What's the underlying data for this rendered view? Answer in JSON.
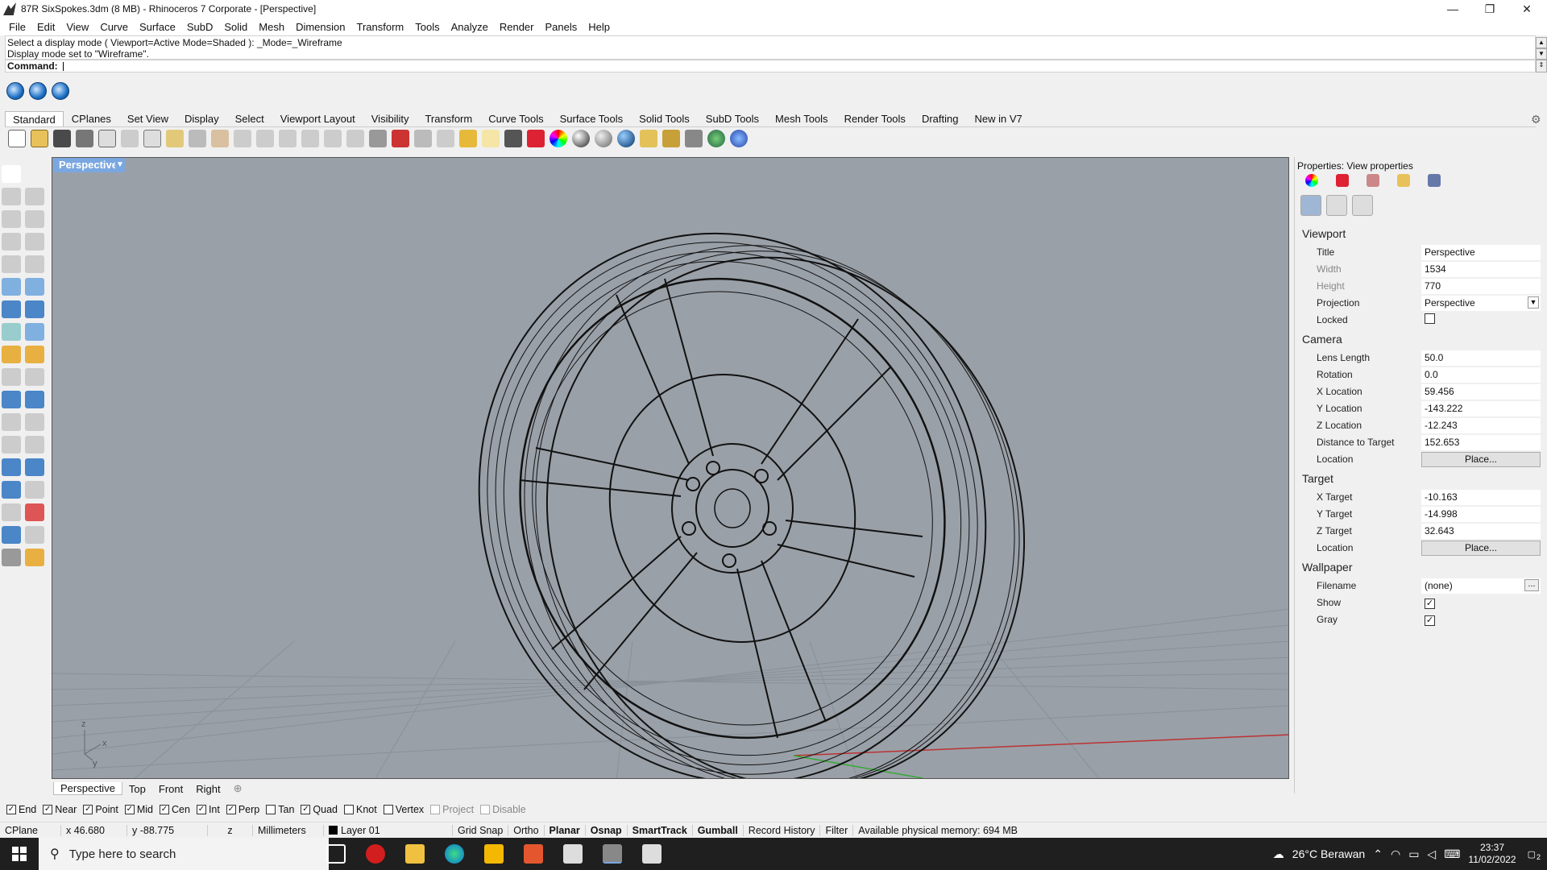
{
  "window": {
    "title": "87R SixSpokes.3dm (8 MB) - Rhinoceros 7 Corporate - [Perspective]",
    "minimize": "—",
    "restore": "❐",
    "close": "✕"
  },
  "menu": [
    "File",
    "Edit",
    "View",
    "Curve",
    "Surface",
    "SubD",
    "Solid",
    "Mesh",
    "Dimension",
    "Transform",
    "Tools",
    "Analyze",
    "Render",
    "Panels",
    "Help"
  ],
  "command": {
    "history_line1": "Select a display mode ( Viewport=Active  Mode=Shaded ): _Mode=_Wireframe",
    "history_line2": "Display mode set to \"Wireframe\".",
    "prompt": "Command:"
  },
  "toolbar_tabs": [
    "Standard",
    "CPlanes",
    "Set View",
    "Display",
    "Select",
    "Viewport Layout",
    "Visibility",
    "Transform",
    "Curve Tools",
    "Surface Tools",
    "Solid Tools",
    "SubD Tools",
    "Mesh Tools",
    "Render Tools",
    "Drafting",
    "New in V7"
  ],
  "viewport": {
    "label": "Perspective",
    "tabs": [
      "Perspective",
      "Top",
      "Front",
      "Right"
    ],
    "add_tab": "⊕",
    "axis_z": "z",
    "axis_y": "y",
    "axis_x": "x"
  },
  "properties": {
    "title": "Properties: View properties",
    "sections": {
      "viewport": "Viewport",
      "camera": "Camera",
      "target": "Target",
      "wallpaper": "Wallpaper"
    },
    "viewport": {
      "title_label": "Title",
      "title_value": "Perspective",
      "width_label": "Width",
      "width_value": "1534",
      "height_label": "Height",
      "height_value": "770",
      "projection_label": "Projection",
      "projection_value": "Perspective",
      "locked_label": "Locked",
      "locked": false
    },
    "camera": {
      "lens_label": "Lens Length",
      "lens_value": "50.0",
      "rotation_label": "Rotation",
      "rotation_value": "0.0",
      "x_label": "X Location",
      "x_value": "59.456",
      "y_label": "Y Location",
      "y_value": "-143.222",
      "z_label": "Z Location",
      "z_value": "-12.243",
      "dist_label": "Distance to Target",
      "dist_value": "152.653",
      "loc_label": "Location",
      "loc_button": "Place..."
    },
    "target": {
      "x_label": "X Target",
      "x_value": "-10.163",
      "y_label": "Y Target",
      "y_value": "-14.998",
      "z_label": "Z Target",
      "z_value": "32.643",
      "loc_label": "Location",
      "loc_button": "Place..."
    },
    "wallpaper": {
      "filename_label": "Filename",
      "filename_value": "(none)",
      "browse": "...",
      "show_label": "Show",
      "show": true,
      "gray_label": "Gray",
      "gray": true
    }
  },
  "osnaps": [
    {
      "label": "End",
      "checked": true
    },
    {
      "label": "Near",
      "checked": true
    },
    {
      "label": "Point",
      "checked": true
    },
    {
      "label": "Mid",
      "checked": true
    },
    {
      "label": "Cen",
      "checked": true
    },
    {
      "label": "Int",
      "checked": true
    },
    {
      "label": "Perp",
      "checked": true
    },
    {
      "label": "Tan",
      "checked": false
    },
    {
      "label": "Quad",
      "checked": true
    },
    {
      "label": "Knot",
      "checked": false
    },
    {
      "label": "Vertex",
      "checked": false
    },
    {
      "label": "Project",
      "checked": false,
      "disabled": true
    },
    {
      "label": "Disable",
      "checked": false,
      "disabled": true
    }
  ],
  "status": {
    "cplane": "CPlane",
    "x": "x 46.680",
    "y": "y -88.775",
    "z": "z",
    "units": "Millimeters",
    "layer": "Layer 01",
    "grid_snap": "Grid Snap",
    "ortho": "Ortho",
    "planar": "Planar",
    "osnap": "Osnap",
    "smarttrack": "SmartTrack",
    "gumball": "Gumball",
    "record_history": "Record History",
    "filter": "Filter",
    "memory": "Available physical memory: 694 MB"
  },
  "taskbar": {
    "search_placeholder": "Type here to search",
    "weather": "26°C  Berawan",
    "time": "23:37",
    "date": "11/02/2022",
    "notification_count": "2"
  },
  "colors": {
    "viewport_bg": "#9aa0a8",
    "active_viewport_label": "#7aa7e0",
    "taskbar": "#1f1f1f"
  }
}
